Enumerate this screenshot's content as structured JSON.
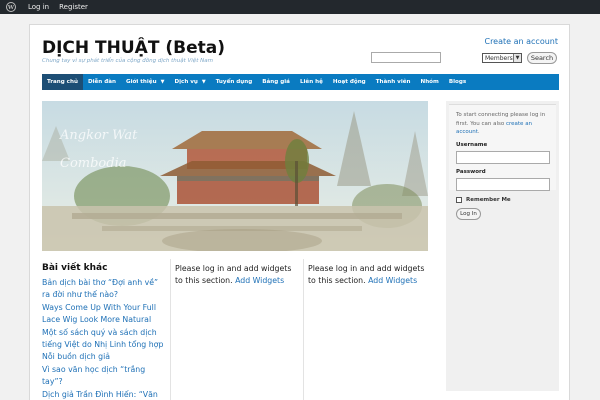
{
  "adminbar": {
    "login": "Log in",
    "register": "Register"
  },
  "site": {
    "title": "DỊCH THUẬT (Beta)",
    "description": "Chung tay vì sự phát triển của cộng đồng dịch thuật Việt Nam"
  },
  "header": {
    "create_account": "Create an account",
    "search_placeholder": "",
    "member_select": "Members",
    "search_button": "Search"
  },
  "nav": {
    "items": [
      {
        "label": "Trang chủ"
      },
      {
        "label": "Diễn đàn"
      },
      {
        "label": "Giới thiệu"
      },
      {
        "label": "Dịch vụ"
      },
      {
        "label": "Tuyển dụng"
      },
      {
        "label": "Bảng giá"
      },
      {
        "label": "Liên hệ"
      },
      {
        "label": "Hoạt động"
      },
      {
        "label": "Thành viên"
      },
      {
        "label": "Nhóm"
      },
      {
        "label": "Blogs"
      }
    ]
  },
  "banner": {
    "line1": "Angkor Wat",
    "line2": "Combodia"
  },
  "posts": {
    "title": "Bài viết khác",
    "items": [
      "Bản dịch bài thơ “Đợi anh về” ra đời như thế nào?",
      "Ways Come Up With Your Full Lace Wig Look More Natural",
      "Một số sách quý và sách dịch tiếng Việt do Nhị Linh tổng hợp",
      "Nỗi buồn dịch giả",
      "Vì sao văn học dịch “trắng tay”?",
      "Dịch giả Trần Đình Hiến: “Văn chương nổi tiếng thì không cứ"
    ]
  },
  "widgets": {
    "text": "Please log in and add widgets to this section.",
    "link": "Add Widgets"
  },
  "login": {
    "note": "To start connecting please log in first. You can also",
    "note_link": "create an account",
    "note_end": ".",
    "username_label": "Username",
    "password_label": "Password",
    "remember_label": "Remember Me",
    "login_button": "Log In"
  }
}
